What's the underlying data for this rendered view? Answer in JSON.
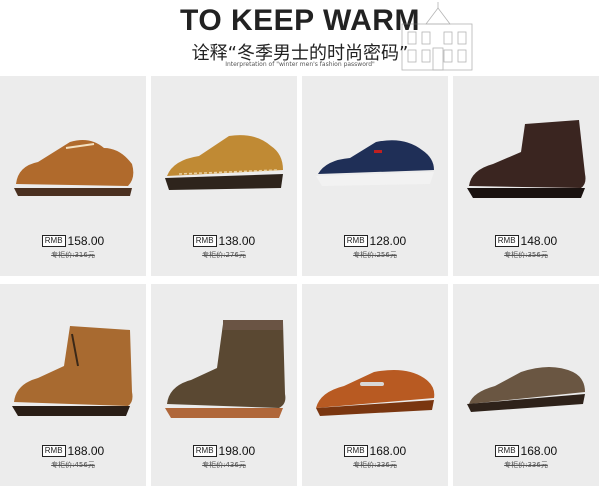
{
  "header": {
    "title": "TO KEEP WARM",
    "subtitle": "诠释“冬季男士的时尚密码”",
    "tagline": "Interpretation of \"winter men's fashion password\""
  },
  "products": [
    {
      "currency": "RMB",
      "price": "158.00",
      "original": "专柜价:316元",
      "color": "#b06a2c"
    },
    {
      "currency": "RMB",
      "price": "138.00",
      "original": "专柜价:276元",
      "color": "#c08a34"
    },
    {
      "currency": "RMB",
      "price": "128.00",
      "original": "专柜价:256元",
      "color": "#1f2f57"
    },
    {
      "currency": "RMB",
      "price": "148.00",
      "original": "专柜价:356元",
      "color": "#3a2520"
    },
    {
      "currency": "RMB",
      "price": "188.00",
      "original": "专柜价:456元",
      "color": "#a86a30"
    },
    {
      "currency": "RMB",
      "price": "198.00",
      "original": "专柜价:436元",
      "color": "#5a4832"
    },
    {
      "currency": "RMB",
      "price": "168.00",
      "original": "专柜价:336元",
      "color": "#b85a22"
    },
    {
      "currency": "RMB",
      "price": "168.00",
      "original": "专柜价:336元",
      "color": "#6a5642"
    }
  ]
}
